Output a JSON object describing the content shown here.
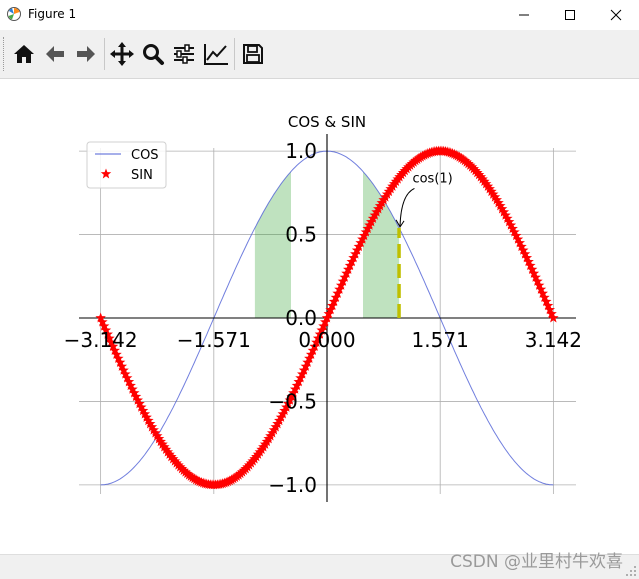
{
  "window": {
    "title": "Figure 1",
    "icon": "matplotlib-icon"
  },
  "toolbar": {
    "buttons": [
      {
        "name": "home-icon"
      },
      {
        "name": "back-icon"
      },
      {
        "name": "forward-icon"
      },
      {
        "name": "pan-icon"
      },
      {
        "name": "zoom-icon"
      },
      {
        "name": "subplots-config-icon"
      },
      {
        "name": "edit-axis-icon"
      },
      {
        "name": "save-icon"
      }
    ]
  },
  "watermark": "CSDN @业里村牛欢喜",
  "chart_data": {
    "type": "line",
    "title": "COS & SIN",
    "xlabel": "",
    "ylabel": "",
    "xlim": [
      -3.3,
      3.3
    ],
    "ylim": [
      -1.1,
      1.1
    ],
    "xticks": [
      -3.142,
      -1.571,
      0.0,
      1.571,
      3.142
    ],
    "xtick_labels": [
      "−3.142",
      "−1.571",
      "0.000",
      "1.571",
      "3.142"
    ],
    "yticks": [
      -1.0,
      -0.5,
      0.0,
      0.5,
      1.0
    ],
    "ytick_labels": [
      "−1.0",
      "−0.5",
      "0.0",
      "0.5",
      "1.0"
    ],
    "grid": true,
    "spines": "centered at origin",
    "legend": {
      "position": "top-left",
      "entries": [
        "COS",
        "SIN"
      ]
    },
    "series": [
      {
        "name": "COS",
        "function": "cos(x)",
        "x_range": [
          -3.142,
          3.142
        ],
        "color": "#4e5fd6",
        "linewidth": 1,
        "marker": "none",
        "alpha": 0.8
      },
      {
        "name": "SIN",
        "function": "sin(x)",
        "x_range": [
          -3.142,
          3.142
        ],
        "color": "#ff0000",
        "linewidth": 4,
        "marker": "star"
      }
    ],
    "fills": [
      {
        "x_range": [
          -1.0,
          1.0
        ],
        "between": [
          "cos(x)",
          0
        ],
        "where": "abs(x) >= 0.5",
        "color": "#2ca02c",
        "alpha": 0.3
      }
    ],
    "vline": {
      "x": 1,
      "y_range": [
        0,
        0.54
      ],
      "color": "#bfbf00",
      "style": "dashed"
    },
    "annotation": {
      "text": "cos(1)",
      "xy": [
        1,
        0.54
      ],
      "text_xy": [
        1.2,
        0.8
      ]
    }
  },
  "colors": {
    "axes_bg": "#ffffff",
    "grid": "#b0b0b0",
    "toolbar_bg": "#f0f0f0"
  }
}
